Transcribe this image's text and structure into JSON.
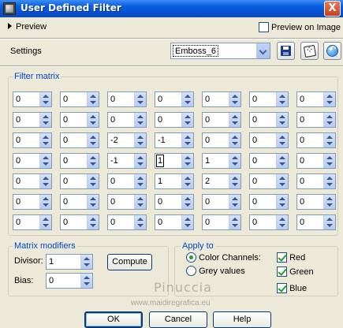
{
  "window": {
    "title": "User Defined Filter",
    "close_glyph": "X"
  },
  "preview": {
    "label": "Preview",
    "on_image_label": "Preview on Image",
    "on_image_checked": false
  },
  "settings": {
    "label": "Settings",
    "preset_value": "Emboss_6"
  },
  "matrix": {
    "label": "Filter matrix",
    "rows": [
      [
        "0",
        "0",
        "0",
        "0",
        "0",
        "0",
        "0"
      ],
      [
        "0",
        "0",
        "0",
        "0",
        "0",
        "0",
        "0"
      ],
      [
        "0",
        "0",
        "-2",
        "-1",
        "0",
        "0",
        "0"
      ],
      [
        "0",
        "0",
        "-1",
        "1",
        "1",
        "0",
        "0"
      ],
      [
        "0",
        "0",
        "0",
        "1",
        "2",
        "0",
        "0"
      ],
      [
        "0",
        "0",
        "0",
        "0",
        "0",
        "0",
        "0"
      ],
      [
        "0",
        "0",
        "0",
        "0",
        "0",
        "0",
        "0"
      ]
    ]
  },
  "modifiers": {
    "label": "Matrix modifiers",
    "divisor_label": "Divisor:",
    "divisor_value": "1",
    "bias_label": "Bias:",
    "bias_value": "0",
    "compute_label": "Compute"
  },
  "apply_to": {
    "label": "Apply to",
    "color_channels_label": "Color Channels:",
    "grey_values_label": "Grey values",
    "red_label": "Red",
    "green_label": "Green",
    "blue_label": "Blue",
    "mode": "color_channels"
  },
  "watermark": {
    "line1": "Pinuccia",
    "line2": "www.maidiregrafica.eu"
  },
  "buttons": {
    "ok": "OK",
    "cancel": "Cancel",
    "help": "Help"
  },
  "colors": {
    "title_bar": "#0a5fe0",
    "group_label": "#0046d5",
    "dialog_bg": "#ece9d8"
  }
}
